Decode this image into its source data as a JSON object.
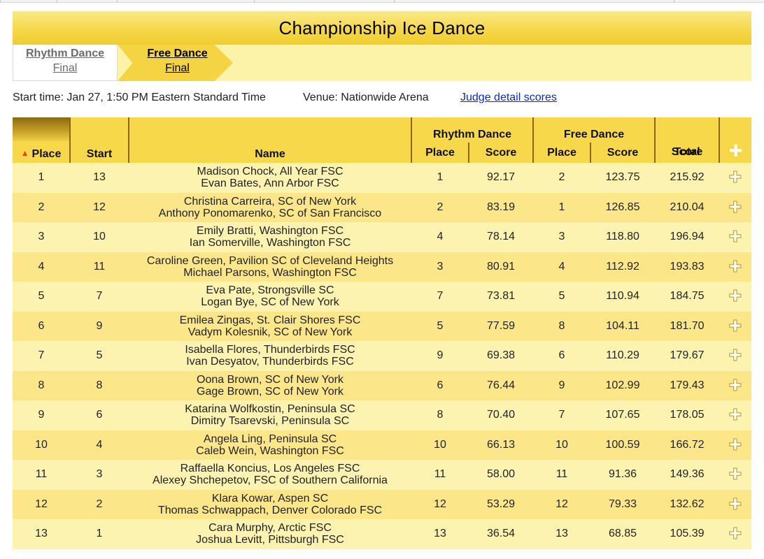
{
  "title": "Championship Ice Dance",
  "tabs": [
    {
      "title": "Rhythm Dance",
      "sub": "Final"
    },
    {
      "title": "Free Dance",
      "sub": "Final"
    }
  ],
  "info": {
    "start_time": "Start time: Jan 27, 1:50 PM Eastern Standard Time",
    "venue": "Venue: Nationwide Arena",
    "judge_link": "Judge detail scores"
  },
  "table": {
    "headers": {
      "place": "Place",
      "start": "Start",
      "name": "Name",
      "rhythm_dance": "Rhythm Dance",
      "free_dance": "Free Dance",
      "sub_place": "Place",
      "sub_score": "Score",
      "total_line1": "Total",
      "total_line2": "Score",
      "expand_icon": "plus-icon"
    },
    "rows": [
      {
        "place": "1",
        "start": "13",
        "skater1": "Madison Chock, All Year FSC",
        "skater2": "Evan Bates, Ann Arbor FSC",
        "rd_place": "1",
        "rd_score": "92.17",
        "fd_place": "2",
        "fd_score": "123.75",
        "total": "215.92"
      },
      {
        "place": "2",
        "start": "12",
        "skater1": "Christina Carreira, SC of New York",
        "skater2": "Anthony Ponomarenko, SC of San Francisco",
        "rd_place": "2",
        "rd_score": "83.19",
        "fd_place": "1",
        "fd_score": "126.85",
        "total": "210.04"
      },
      {
        "place": "3",
        "start": "10",
        "skater1": "Emily Bratti, Washington FSC",
        "skater2": "Ian Somerville, Washington FSC",
        "rd_place": "4",
        "rd_score": "78.14",
        "fd_place": "3",
        "fd_score": "118.80",
        "total": "196.94"
      },
      {
        "place": "4",
        "start": "11",
        "skater1": "Caroline Green, Pavilion SC of Cleveland Heights",
        "skater2": "Michael Parsons, Washington FSC",
        "rd_place": "3",
        "rd_score": "80.91",
        "fd_place": "4",
        "fd_score": "112.92",
        "total": "193.83"
      },
      {
        "place": "5",
        "start": "7",
        "skater1": "Eva Pate, Strongsville SC",
        "skater2": "Logan Bye, SC of New York",
        "rd_place": "7",
        "rd_score": "73.81",
        "fd_place": "5",
        "fd_score": "110.94",
        "total": "184.75"
      },
      {
        "place": "6",
        "start": "9",
        "skater1": "Emilea Zingas, St. Clair Shores FSC",
        "skater2": "Vadym Kolesnik, SC of New York",
        "rd_place": "5",
        "rd_score": "77.59",
        "fd_place": "8",
        "fd_score": "104.11",
        "total": "181.70"
      },
      {
        "place": "7",
        "start": "5",
        "skater1": "Isabella Flores, Thunderbirds FSC",
        "skater2": "Ivan Desyatov, Thunderbirds FSC",
        "rd_place": "9",
        "rd_score": "69.38",
        "fd_place": "6",
        "fd_score": "110.29",
        "total": "179.67"
      },
      {
        "place": "8",
        "start": "8",
        "skater1": "Oona Brown, SC of New York",
        "skater2": "Gage Brown, SC of New York",
        "rd_place": "6",
        "rd_score": "76.44",
        "fd_place": "9",
        "fd_score": "102.99",
        "total": "179.43"
      },
      {
        "place": "9",
        "start": "6",
        "skater1": "Katarina Wolfkostin, Peninsula SC",
        "skater2": "Dimitry Tsarevski, Peninsula SC",
        "rd_place": "8",
        "rd_score": "70.40",
        "fd_place": "7",
        "fd_score": "107.65",
        "total": "178.05"
      },
      {
        "place": "10",
        "start": "4",
        "skater1": "Angela Ling, Peninsula SC",
        "skater2": "Caleb Wein, Washington FSC",
        "rd_place": "10",
        "rd_score": "66.13",
        "fd_place": "10",
        "fd_score": "100.59",
        "total": "166.72"
      },
      {
        "place": "11",
        "start": "3",
        "skater1": "Raffaella Koncius, Los Angeles FSC",
        "skater2": "Alexey Shchepetov, FSC of Southern California",
        "rd_place": "11",
        "rd_score": "58.00",
        "fd_place": "11",
        "fd_score": "91.36",
        "total": "149.36"
      },
      {
        "place": "12",
        "start": "2",
        "skater1": "Klara Kowar, Aspen SC",
        "skater2": "Thomas Schwappach, Denver Colorado FSC",
        "rd_place": "12",
        "rd_score": "53.29",
        "fd_place": "12",
        "fd_score": "79.33",
        "total": "132.62"
      },
      {
        "place": "13",
        "start": "1",
        "skater1": "Cara Murphy, Arctic FSC",
        "skater2": "Joshua Levitt, Pittsburgh FSC",
        "rd_place": "13",
        "rd_score": "36.54",
        "fd_place": "13",
        "fd_score": "68.85",
        "total": "105.39"
      }
    ]
  }
}
